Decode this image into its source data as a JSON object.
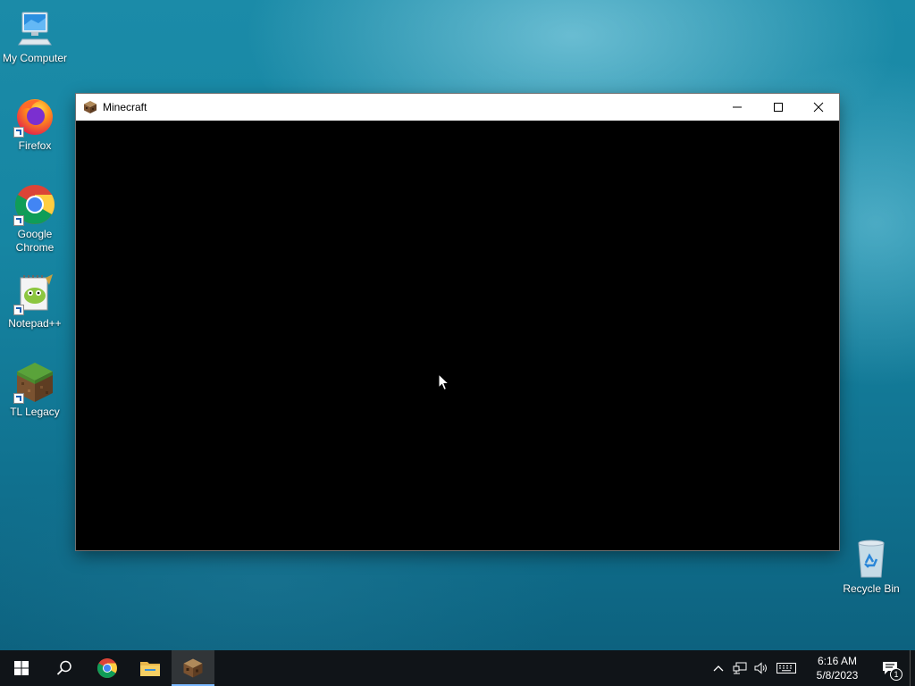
{
  "desktop": {
    "icons": [
      {
        "label": "My Computer"
      },
      {
        "label": "Firefox"
      },
      {
        "label": "Google\nChrome"
      },
      {
        "label": "Notepad++"
      },
      {
        "label": "TL Legacy"
      },
      {
        "label": "Recycle Bin"
      }
    ]
  },
  "window": {
    "title": "Minecraft"
  },
  "taskbar": {
    "clock_time": "6:16 AM",
    "clock_date": "5/8/2023",
    "notification_count": "1"
  }
}
